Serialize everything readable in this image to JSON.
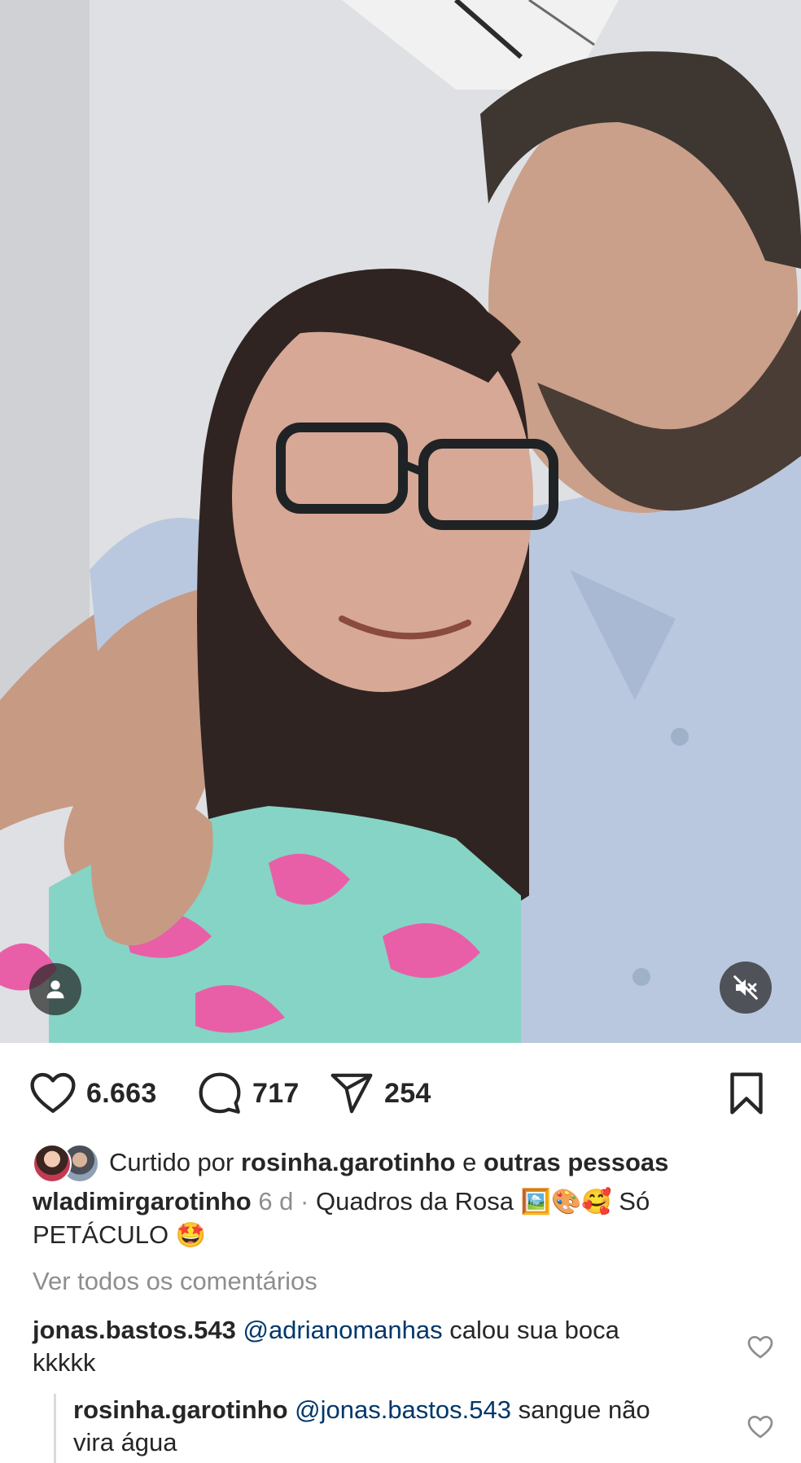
{
  "post": {
    "likes_count": "6.663",
    "comments_count": "717",
    "shares_count": "254",
    "liked_by_prefix": "Curtido por",
    "liked_by_user": "rosinha.garotinho",
    "liked_by_joiner": "e",
    "liked_by_others": "outras pessoas",
    "author": "wladimirgarotinho",
    "time_ago": "6 d",
    "separator": "·",
    "caption_text": "Quadros da Rosa",
    "caption_emojis": "🖼️🎨🥰",
    "caption_tail": "Só PETÁCULO",
    "caption_end_emoji": "🤩",
    "view_all_comments": "Ver todos os comentários"
  },
  "comments": [
    {
      "user": "jonas.bastos.543",
      "mention": "@adrianomanhas",
      "text": "calou sua boca kkkkk"
    },
    {
      "user": "rosinha.garotinho",
      "mention": "@jonas.bastos.543",
      "text": "sangue não vira água"
    }
  ],
  "icons": {
    "like": "heart-icon",
    "comment": "comment-bubble-icon",
    "share": "paper-plane-icon",
    "save": "bookmark-icon",
    "user_tag": "person-icon",
    "mute": "speaker-muted-icon"
  },
  "colors": {
    "text": "#262626",
    "secondary": "#8e8e8e",
    "mention": "#00376b"
  }
}
